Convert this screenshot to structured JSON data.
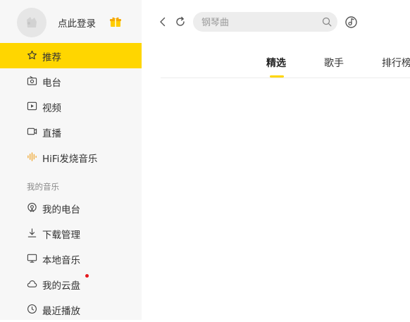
{
  "user": {
    "login_text": "点此登录"
  },
  "nav": {
    "items": [
      {
        "label": "推荐",
        "icon": "star-icon"
      },
      {
        "label": "电台",
        "icon": "radio-icon"
      },
      {
        "label": "视频",
        "icon": "video-icon"
      },
      {
        "label": "直播",
        "icon": "live-camera-icon"
      },
      {
        "label": "HiFi发烧音乐",
        "icon": "hifi-waveform-icon"
      }
    ],
    "active_index": 0
  },
  "my_music": {
    "title": "我的音乐",
    "items": [
      {
        "label": "我的电台",
        "icon": "podcast-icon"
      },
      {
        "label": "下载管理",
        "icon": "download-icon"
      },
      {
        "label": "本地音乐",
        "icon": "monitor-icon"
      },
      {
        "label": "我的云盘",
        "icon": "cloud-icon",
        "has_notification_dot": true
      },
      {
        "label": "最近播放",
        "icon": "clock-icon"
      }
    ]
  },
  "search": {
    "placeholder": "钢琴曲"
  },
  "tabs": [
    {
      "label": "精选",
      "active": true
    },
    {
      "label": "歌手",
      "active": false
    },
    {
      "label": "排行榜",
      "active": false
    }
  ],
  "colors": {
    "accent": "#ffd600",
    "sidebar_bg": "#f7f7f7",
    "notification_dot": "#e5191e"
  }
}
